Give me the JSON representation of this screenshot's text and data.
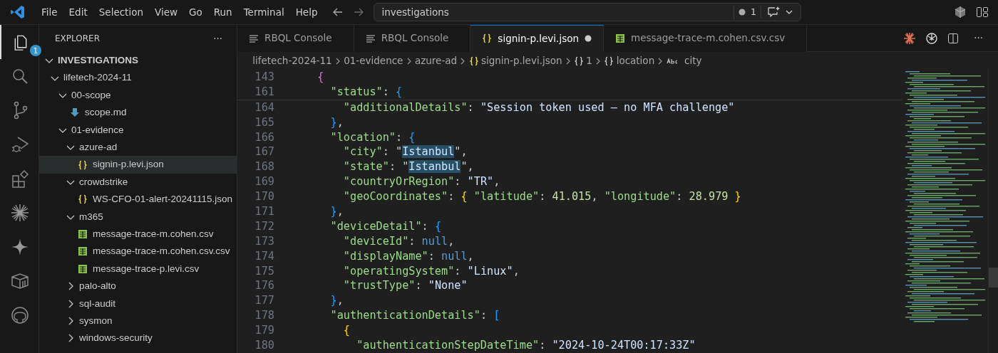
{
  "menu": [
    "File",
    "Edit",
    "Selection",
    "View",
    "Go",
    "Run",
    "Terminal",
    "Help"
  ],
  "command_center": {
    "value": "investigations",
    "problems": "1"
  },
  "activity_bar": {
    "explorer_badge": "1"
  },
  "sidebar": {
    "title": "EXPLORER",
    "more": "···",
    "root": {
      "label": "INVESTIGATIONS",
      "expanded": true
    },
    "tree": [
      {
        "label": "lifetech-2024-11",
        "kind": "folder",
        "expanded": true,
        "selected": false,
        "children": [
          {
            "label": "00-scope",
            "kind": "folder",
            "expanded": true,
            "selected": false,
            "children": [
              {
                "label": "scope.md",
                "kind": "markdown",
                "selected": false
              }
            ]
          },
          {
            "label": "01-evidence",
            "kind": "folder",
            "expanded": true,
            "selected": false,
            "children": [
              {
                "label": "azure-ad",
                "kind": "folder",
                "expanded": true,
                "selected": false,
                "children": [
                  {
                    "label": "signin-p.levi.json",
                    "kind": "json",
                    "selected": true
                  }
                ]
              },
              {
                "label": "crowdstrike",
                "kind": "folder",
                "expanded": true,
                "selected": false,
                "children": [
                  {
                    "label": "WS-CFO-01-alert-20241115.json",
                    "kind": "json",
                    "selected": false
                  }
                ]
              },
              {
                "label": "m365",
                "kind": "folder",
                "expanded": true,
                "selected": false,
                "children": [
                  {
                    "label": "message-trace-m.cohen.csv",
                    "kind": "csv",
                    "selected": false
                  },
                  {
                    "label": "message-trace-m.cohen.csv.csv",
                    "kind": "csv",
                    "selected": false
                  },
                  {
                    "label": "message-trace-p.levi.csv",
                    "kind": "csv",
                    "selected": false
                  }
                ]
              },
              {
                "label": "palo-alto",
                "kind": "folder",
                "expanded": false,
                "selected": false
              },
              {
                "label": "sql-audit",
                "kind": "folder",
                "expanded": false,
                "selected": false
              },
              {
                "label": "sysmon",
                "kind": "folder",
                "expanded": false,
                "selected": false
              },
              {
                "label": "windows-security",
                "kind": "folder",
                "expanded": false,
                "selected": false
              }
            ]
          }
        ]
      }
    ]
  },
  "tabs": [
    {
      "label": "RBQL Console",
      "kind": "console",
      "selected": false,
      "modified": false
    },
    {
      "label": "RBQL Console",
      "kind": "console",
      "selected": false,
      "modified": false
    },
    {
      "label": "signin-p.levi.json",
      "kind": "json",
      "selected": true,
      "modified": true
    },
    {
      "label": "message-trace-m.cohen.csv.csv",
      "kind": "csv",
      "selected": false,
      "modified": false
    }
  ],
  "breadcrumbs": [
    {
      "label": "lifetech-2024-11",
      "kind": "folder"
    },
    {
      "label": "01-evidence",
      "kind": "folder"
    },
    {
      "label": "azure-ad",
      "kind": "folder"
    },
    {
      "label": "signin-p.levi.json",
      "kind": "json"
    },
    {
      "label": "1",
      "kind": "object"
    },
    {
      "label": "location",
      "kind": "object"
    },
    {
      "label": "city",
      "kind": "string"
    }
  ],
  "editor": {
    "sticky_lines": [
      {
        "number": "143",
        "tokens": [
          {
            "kind": "bracket2",
            "text": "{"
          }
        ]
      },
      {
        "number": "161",
        "tokens": [
          {
            "kind": "key",
            "text": "\"status\""
          },
          {
            "kind": "punct",
            "text": ": "
          },
          {
            "kind": "bracket3",
            "text": "{"
          }
        ]
      }
    ],
    "lines": [
      {
        "number": "164",
        "tokens": [
          {
            "kind": "key",
            "text": "\"additionalDetails\""
          },
          {
            "kind": "punct",
            "text": ": "
          },
          {
            "kind": "string",
            "text": "\"Session token used — no MFA challenge\""
          }
        ]
      },
      {
        "number": "165",
        "tokens": [
          {
            "kind": "bracket3",
            "text": "}"
          },
          {
            "kind": "punct",
            "text": ","
          }
        ]
      },
      {
        "number": "166",
        "tokens": [
          {
            "kind": "key",
            "text": "\"location\""
          },
          {
            "kind": "punct",
            "text": ": "
          },
          {
            "kind": "bracket3",
            "text": "{"
          }
        ]
      },
      {
        "number": "167",
        "tokens": [
          {
            "kind": "key",
            "text": "\"city\""
          },
          {
            "kind": "punct",
            "text": ": \""
          },
          {
            "kind": "highlight",
            "text": "Istanbul"
          },
          {
            "kind": "punct",
            "text": "\","
          }
        ]
      },
      {
        "number": "168",
        "tokens": [
          {
            "kind": "key",
            "text": "\"state\""
          },
          {
            "kind": "punct",
            "text": ": \""
          },
          {
            "kind": "highlight",
            "text": "Istanbul"
          },
          {
            "kind": "punct",
            "text": "\","
          }
        ]
      },
      {
        "number": "169",
        "tokens": [
          {
            "kind": "key",
            "text": "\"countryOrRegion\""
          },
          {
            "kind": "punct",
            "text": ": "
          },
          {
            "kind": "string",
            "text": "\"TR\""
          },
          {
            "kind": "punct",
            "text": ","
          }
        ]
      },
      {
        "number": "170",
        "tokens": [
          {
            "kind": "key",
            "text": "\"geoCoordinates\""
          },
          {
            "kind": "punct",
            "text": ": "
          },
          {
            "kind": "bracket1",
            "text": "{"
          },
          {
            "kind": "key",
            "text": " \"latitude\""
          },
          {
            "kind": "punct",
            "text": ": "
          },
          {
            "kind": "number",
            "text": "41.015"
          },
          {
            "kind": "punct",
            "text": ", "
          },
          {
            "kind": "key",
            "text": "\"longitude\""
          },
          {
            "kind": "punct",
            "text": ": "
          },
          {
            "kind": "number",
            "text": "28.979"
          },
          {
            "kind": "bracket1",
            "text": " }"
          }
        ]
      },
      {
        "number": "171",
        "tokens": [
          {
            "kind": "bracket3",
            "text": "}"
          },
          {
            "kind": "punct",
            "text": ","
          }
        ]
      },
      {
        "number": "172",
        "tokens": [
          {
            "kind": "key",
            "text": "\"deviceDetail\""
          },
          {
            "kind": "punct",
            "text": ": "
          },
          {
            "kind": "bracket3",
            "text": "{"
          }
        ]
      },
      {
        "number": "173",
        "tokens": [
          {
            "kind": "key",
            "text": "\"deviceId\""
          },
          {
            "kind": "punct",
            "text": ": "
          },
          {
            "kind": "null",
            "text": "null"
          },
          {
            "kind": "punct",
            "text": ","
          }
        ]
      },
      {
        "number": "174",
        "tokens": [
          {
            "kind": "key",
            "text": "\"displayName\""
          },
          {
            "kind": "punct",
            "text": ": "
          },
          {
            "kind": "null",
            "text": "null"
          },
          {
            "kind": "punct",
            "text": ","
          }
        ]
      },
      {
        "number": "175",
        "tokens": [
          {
            "kind": "key",
            "text": "\"operatingSystem\""
          },
          {
            "kind": "punct",
            "text": ": "
          },
          {
            "kind": "string",
            "text": "\"Linux\""
          },
          {
            "kind": "punct",
            "text": ","
          }
        ]
      },
      {
        "number": "176",
        "tokens": [
          {
            "kind": "key",
            "text": "\"trustType\""
          },
          {
            "kind": "punct",
            "text": ": "
          },
          {
            "kind": "string",
            "text": "\"None\""
          }
        ]
      },
      {
        "number": "177",
        "tokens": [
          {
            "kind": "bracket3",
            "text": "}"
          },
          {
            "kind": "punct",
            "text": ","
          }
        ]
      },
      {
        "number": "178",
        "tokens": [
          {
            "kind": "key",
            "text": "\"authenticationDetails\""
          },
          {
            "kind": "punct",
            "text": ": "
          },
          {
            "kind": "bracket3",
            "text": "["
          }
        ]
      },
      {
        "number": "179",
        "tokens": [
          {
            "kind": "bracket1",
            "text": "{"
          }
        ]
      },
      {
        "number": "180",
        "tokens": [
          {
            "kind": "key",
            "text": "\"authenticationStepDateTime\""
          },
          {
            "kind": "punct",
            "text": ": "
          },
          {
            "kind": "string",
            "text": "\"2024-10-24T00:17:33Z\""
          }
        ]
      }
    ]
  }
}
